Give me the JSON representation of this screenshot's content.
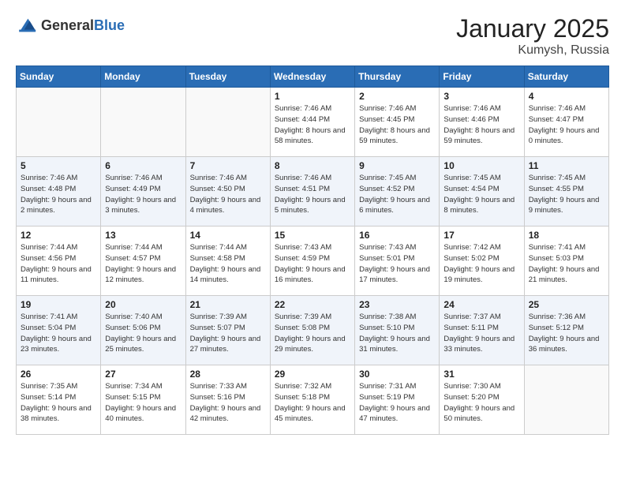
{
  "header": {
    "logo_general": "General",
    "logo_blue": "Blue",
    "month": "January 2025",
    "location": "Kumysh, Russia"
  },
  "weekdays": [
    "Sunday",
    "Monday",
    "Tuesday",
    "Wednesday",
    "Thursday",
    "Friday",
    "Saturday"
  ],
  "weeks": [
    [
      {
        "day": "",
        "sunrise": "",
        "sunset": "",
        "daylight": ""
      },
      {
        "day": "",
        "sunrise": "",
        "sunset": "",
        "daylight": ""
      },
      {
        "day": "",
        "sunrise": "",
        "sunset": "",
        "daylight": ""
      },
      {
        "day": "1",
        "sunrise": "Sunrise: 7:46 AM",
        "sunset": "Sunset: 4:44 PM",
        "daylight": "Daylight: 8 hours and 58 minutes."
      },
      {
        "day": "2",
        "sunrise": "Sunrise: 7:46 AM",
        "sunset": "Sunset: 4:45 PM",
        "daylight": "Daylight: 8 hours and 59 minutes."
      },
      {
        "day": "3",
        "sunrise": "Sunrise: 7:46 AM",
        "sunset": "Sunset: 4:46 PM",
        "daylight": "Daylight: 8 hours and 59 minutes."
      },
      {
        "day": "4",
        "sunrise": "Sunrise: 7:46 AM",
        "sunset": "Sunset: 4:47 PM",
        "daylight": "Daylight: 9 hours and 0 minutes."
      }
    ],
    [
      {
        "day": "5",
        "sunrise": "Sunrise: 7:46 AM",
        "sunset": "Sunset: 4:48 PM",
        "daylight": "Daylight: 9 hours and 2 minutes."
      },
      {
        "day": "6",
        "sunrise": "Sunrise: 7:46 AM",
        "sunset": "Sunset: 4:49 PM",
        "daylight": "Daylight: 9 hours and 3 minutes."
      },
      {
        "day": "7",
        "sunrise": "Sunrise: 7:46 AM",
        "sunset": "Sunset: 4:50 PM",
        "daylight": "Daylight: 9 hours and 4 minutes."
      },
      {
        "day": "8",
        "sunrise": "Sunrise: 7:46 AM",
        "sunset": "Sunset: 4:51 PM",
        "daylight": "Daylight: 9 hours and 5 minutes."
      },
      {
        "day": "9",
        "sunrise": "Sunrise: 7:45 AM",
        "sunset": "Sunset: 4:52 PM",
        "daylight": "Daylight: 9 hours and 6 minutes."
      },
      {
        "day": "10",
        "sunrise": "Sunrise: 7:45 AM",
        "sunset": "Sunset: 4:54 PM",
        "daylight": "Daylight: 9 hours and 8 minutes."
      },
      {
        "day": "11",
        "sunrise": "Sunrise: 7:45 AM",
        "sunset": "Sunset: 4:55 PM",
        "daylight": "Daylight: 9 hours and 9 minutes."
      }
    ],
    [
      {
        "day": "12",
        "sunrise": "Sunrise: 7:44 AM",
        "sunset": "Sunset: 4:56 PM",
        "daylight": "Daylight: 9 hours and 11 minutes."
      },
      {
        "day": "13",
        "sunrise": "Sunrise: 7:44 AM",
        "sunset": "Sunset: 4:57 PM",
        "daylight": "Daylight: 9 hours and 12 minutes."
      },
      {
        "day": "14",
        "sunrise": "Sunrise: 7:44 AM",
        "sunset": "Sunset: 4:58 PM",
        "daylight": "Daylight: 9 hours and 14 minutes."
      },
      {
        "day": "15",
        "sunrise": "Sunrise: 7:43 AM",
        "sunset": "Sunset: 4:59 PM",
        "daylight": "Daylight: 9 hours and 16 minutes."
      },
      {
        "day": "16",
        "sunrise": "Sunrise: 7:43 AM",
        "sunset": "Sunset: 5:01 PM",
        "daylight": "Daylight: 9 hours and 17 minutes."
      },
      {
        "day": "17",
        "sunrise": "Sunrise: 7:42 AM",
        "sunset": "Sunset: 5:02 PM",
        "daylight": "Daylight: 9 hours and 19 minutes."
      },
      {
        "day": "18",
        "sunrise": "Sunrise: 7:41 AM",
        "sunset": "Sunset: 5:03 PM",
        "daylight": "Daylight: 9 hours and 21 minutes."
      }
    ],
    [
      {
        "day": "19",
        "sunrise": "Sunrise: 7:41 AM",
        "sunset": "Sunset: 5:04 PM",
        "daylight": "Daylight: 9 hours and 23 minutes."
      },
      {
        "day": "20",
        "sunrise": "Sunrise: 7:40 AM",
        "sunset": "Sunset: 5:06 PM",
        "daylight": "Daylight: 9 hours and 25 minutes."
      },
      {
        "day": "21",
        "sunrise": "Sunrise: 7:39 AM",
        "sunset": "Sunset: 5:07 PM",
        "daylight": "Daylight: 9 hours and 27 minutes."
      },
      {
        "day": "22",
        "sunrise": "Sunrise: 7:39 AM",
        "sunset": "Sunset: 5:08 PM",
        "daylight": "Daylight: 9 hours and 29 minutes."
      },
      {
        "day": "23",
        "sunrise": "Sunrise: 7:38 AM",
        "sunset": "Sunset: 5:10 PM",
        "daylight": "Daylight: 9 hours and 31 minutes."
      },
      {
        "day": "24",
        "sunrise": "Sunrise: 7:37 AM",
        "sunset": "Sunset: 5:11 PM",
        "daylight": "Daylight: 9 hours and 33 minutes."
      },
      {
        "day": "25",
        "sunrise": "Sunrise: 7:36 AM",
        "sunset": "Sunset: 5:12 PM",
        "daylight": "Daylight: 9 hours and 36 minutes."
      }
    ],
    [
      {
        "day": "26",
        "sunrise": "Sunrise: 7:35 AM",
        "sunset": "Sunset: 5:14 PM",
        "daylight": "Daylight: 9 hours and 38 minutes."
      },
      {
        "day": "27",
        "sunrise": "Sunrise: 7:34 AM",
        "sunset": "Sunset: 5:15 PM",
        "daylight": "Daylight: 9 hours and 40 minutes."
      },
      {
        "day": "28",
        "sunrise": "Sunrise: 7:33 AM",
        "sunset": "Sunset: 5:16 PM",
        "daylight": "Daylight: 9 hours and 42 minutes."
      },
      {
        "day": "29",
        "sunrise": "Sunrise: 7:32 AM",
        "sunset": "Sunset: 5:18 PM",
        "daylight": "Daylight: 9 hours and 45 minutes."
      },
      {
        "day": "30",
        "sunrise": "Sunrise: 7:31 AM",
        "sunset": "Sunset: 5:19 PM",
        "daylight": "Daylight: 9 hours and 47 minutes."
      },
      {
        "day": "31",
        "sunrise": "Sunrise: 7:30 AM",
        "sunset": "Sunset: 5:20 PM",
        "daylight": "Daylight: 9 hours and 50 minutes."
      },
      {
        "day": "",
        "sunrise": "",
        "sunset": "",
        "daylight": ""
      }
    ]
  ]
}
